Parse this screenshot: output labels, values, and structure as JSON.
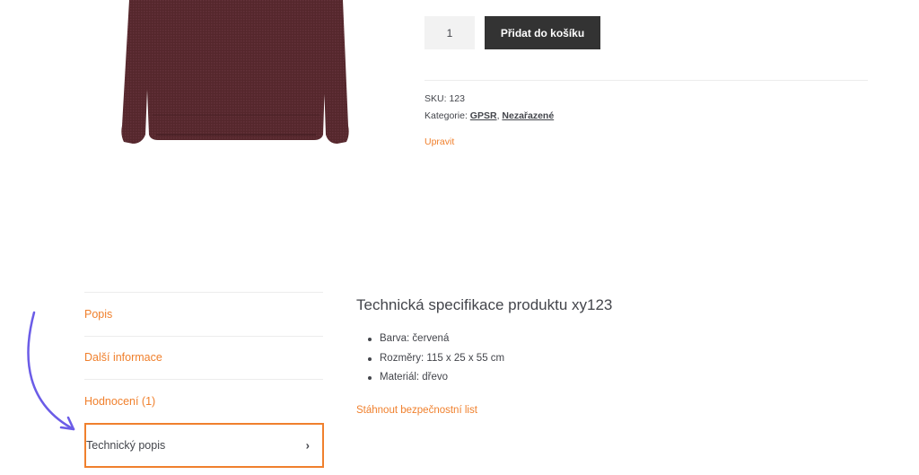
{
  "product": {
    "image_alt": "sweater",
    "quantity": "1",
    "add_to_cart_label": "Přidat do košíku"
  },
  "meta": {
    "sku_label": "SKU:",
    "sku_value": "123",
    "category_label": "Kategorie:",
    "categories": [
      "GPSR",
      "Nezařazené"
    ],
    "category_separator": ",",
    "edit_label": "Upravit"
  },
  "tabs": [
    {
      "label": "Popis"
    },
    {
      "label": "Další informace"
    },
    {
      "label": "Hodnocení (1)"
    },
    {
      "label": "Technický popis",
      "active": true
    }
  ],
  "panel": {
    "title": "Technická specifikace produktu xy123",
    "specs": [
      "Barva: červená",
      "Rozměry: 115 x 25 x 55 cm",
      "Materiál: dřevo"
    ],
    "download_label": "Stáhnout bezpečnostní list"
  },
  "colors": {
    "accent": "#f0802d",
    "button_bg": "#333333",
    "text": "#43454b",
    "arrow": "#6b5ce7",
    "sweater": "#5a2a2f"
  },
  "icons": {
    "tab_chevron": "chevron-right-icon",
    "annotation": "annotation-arrow-icon"
  }
}
